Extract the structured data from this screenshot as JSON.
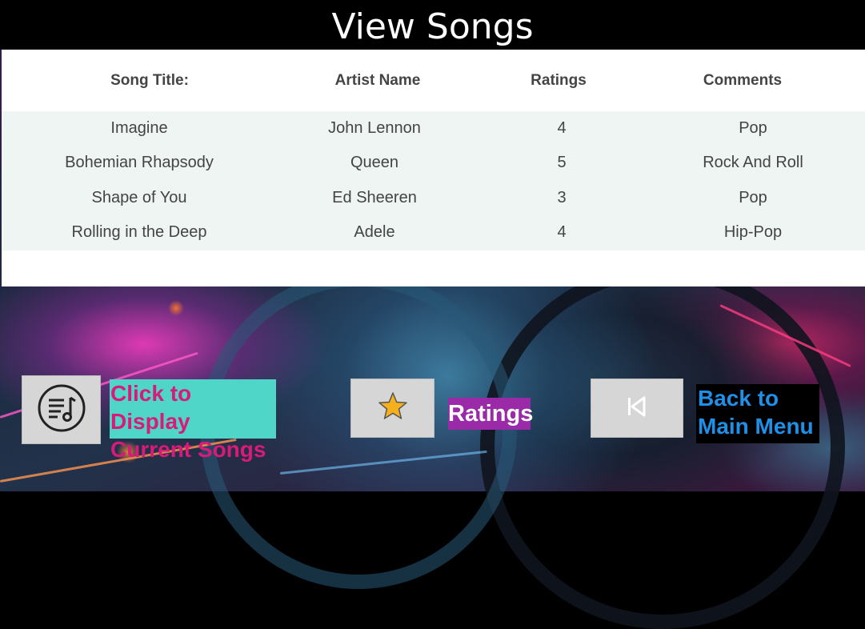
{
  "header": {
    "title": "View Songs"
  },
  "table": {
    "columns": [
      "Song Title:",
      "Artist Name",
      "Ratings",
      "Comments"
    ],
    "rows": [
      [
        "Imagine",
        "John Lennon",
        "4",
        "Pop"
      ],
      [
        "Bohemian Rhapsody",
        "Queen",
        "5",
        "Rock And Roll"
      ],
      [
        "Shape of You",
        "Ed Sheeren",
        "3",
        "Pop"
      ],
      [
        "Rolling in the Deep",
        "Adele",
        "4",
        "Hip-Pop"
      ]
    ]
  },
  "buttons": {
    "display": {
      "icon": "playlist-music-icon",
      "label_line1": "Click to Display",
      "label_line2": "Current Songs"
    },
    "ratings": {
      "icon": "star-icon",
      "label": "Ratings"
    },
    "back": {
      "icon": "skip-back-icon",
      "label_line1": "Back to",
      "label_line2": "Main Menu"
    }
  },
  "colors": {
    "header_bg": "#000000",
    "row_bg": "#eef5f3",
    "display_label_bg": "#4fd6c9",
    "display_label_text": "#d81b78",
    "ratings_label_bg": "#9a2aa8",
    "back_label_text": "#1e90e8"
  }
}
